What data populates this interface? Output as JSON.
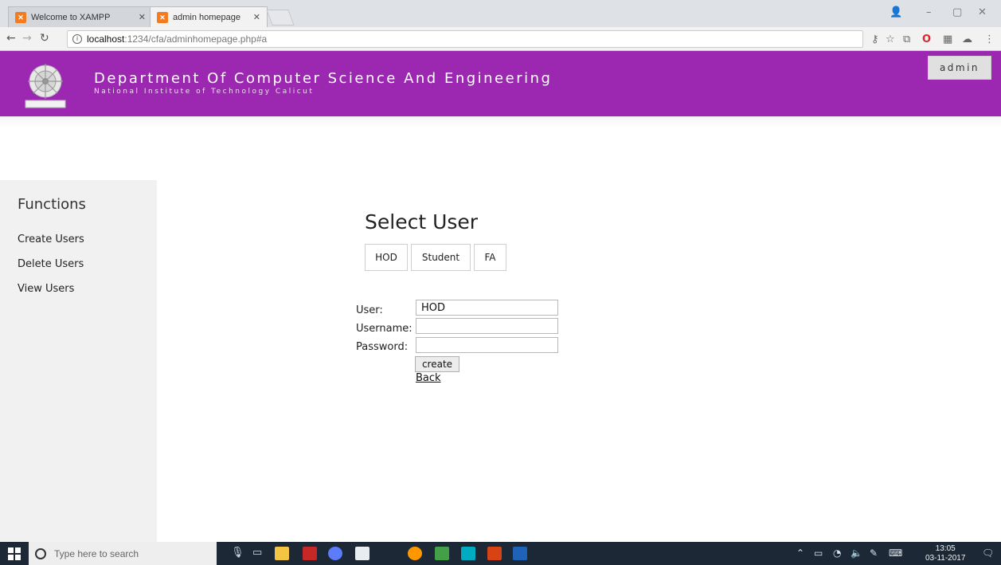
{
  "browser": {
    "tabs": [
      {
        "title": "Welcome to XAMPP",
        "active": false
      },
      {
        "title": "admin homepage",
        "active": true
      }
    ],
    "url_host": "localhost",
    "url_path": ":1234/cfa/adminhomepage.php#a"
  },
  "header": {
    "department": "Department Of Computer Science And Engineering",
    "institute": "National Institute of Technology Calicut",
    "admin_label": "admin"
  },
  "sidebar": {
    "title": "Functions",
    "items": [
      {
        "label": "Create Users"
      },
      {
        "label": "Delete Users"
      },
      {
        "label": "View Users"
      }
    ]
  },
  "main": {
    "title": "Select User",
    "user_types": [
      {
        "label": "HOD"
      },
      {
        "label": "Student"
      },
      {
        "label": "FA"
      }
    ],
    "form": {
      "user_label": "User:",
      "user_value": "HOD",
      "username_label": "Username:",
      "username_value": "",
      "password_label": "Password:",
      "password_value": "",
      "create_label": "create",
      "back_label": "Back"
    }
  },
  "taskbar": {
    "search_placeholder": "Type here to search",
    "time": "13:05",
    "date": "03-11-2017"
  },
  "colors": {
    "header_bg": "#9c27b0",
    "sidebar_bg": "#f1f1f1",
    "taskbar_bg": "#1c2836"
  }
}
